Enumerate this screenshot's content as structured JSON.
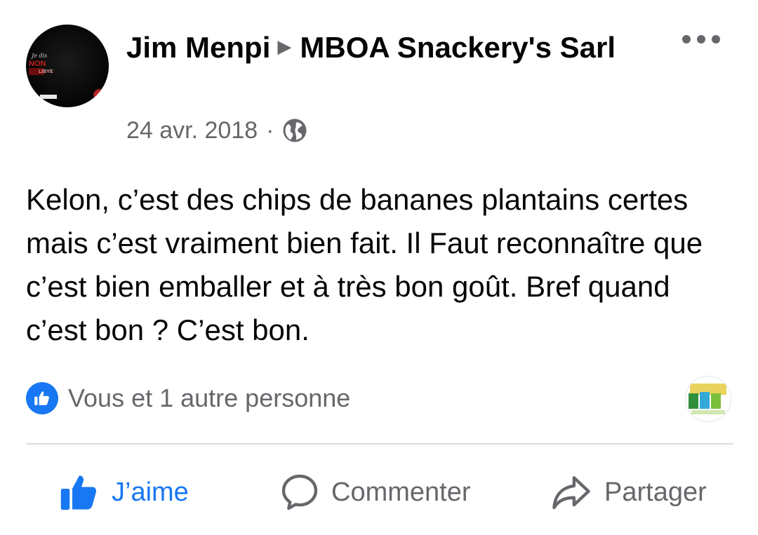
{
  "post": {
    "author": "Jim Menpi",
    "target_page": "MBOA Snackery's Sarl",
    "date": "24 avr. 2018",
    "date_separator": "·",
    "privacy_icon": "globe-icon",
    "text": "Kelon, c’est des chips de bananes plantains certes mais c’est vraiment bien fait. Il Faut reconnaître que c’est bien emballer et à très bon goût. Bref quand c’est bon ? C’est bon.",
    "avatar_text": {
      "line1": "Je dis",
      "line2": "NON",
      "line3": "LIBYE"
    }
  },
  "reactions": {
    "icon": "like-icon",
    "summary": "Vous et 1 autre personne"
  },
  "actions": {
    "like_label": "J’aime",
    "comment_label": "Commenter",
    "share_label": "Partager"
  },
  "colors": {
    "accent": "#1877f2",
    "secondary_text": "#65676b",
    "primary_text": "#050505",
    "divider": "#dadde1"
  }
}
